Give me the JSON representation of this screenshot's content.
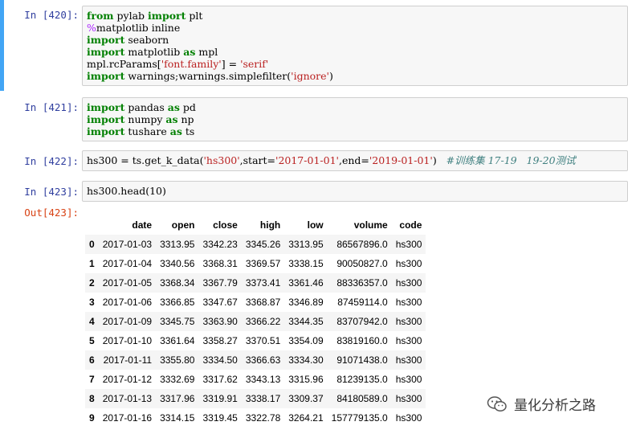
{
  "cells": [
    {
      "prompt": "In  [420]:",
      "code_lines": [
        [
          {
            "t": "from",
            "c": "kw"
          },
          {
            "t": " pylab ",
            "c": "op"
          },
          {
            "t": "import",
            "c": "kw"
          },
          {
            "t": " plt",
            "c": "op"
          }
        ],
        [
          {
            "t": "%",
            "c": "mg"
          },
          {
            "t": "matplotlib inline",
            "c": "op"
          }
        ],
        [
          {
            "t": "import",
            "c": "kw"
          },
          {
            "t": " seaborn",
            "c": "op"
          }
        ],
        [
          {
            "t": "import",
            "c": "kw"
          },
          {
            "t": " matplotlib ",
            "c": "op"
          },
          {
            "t": "as",
            "c": "kw"
          },
          {
            "t": " mpl",
            "c": "op"
          }
        ],
        [
          {
            "t": "mpl.rcParams[",
            "c": "op"
          },
          {
            "t": "'font.family'",
            "c": "str"
          },
          {
            "t": "] = ",
            "c": "op"
          },
          {
            "t": "'serif'",
            "c": "str"
          }
        ],
        [
          {
            "t": "import",
            "c": "kw"
          },
          {
            "t": " warnings;warnings.simplefilter(",
            "c": "op"
          },
          {
            "t": "'ignore'",
            "c": "str"
          },
          {
            "t": ")",
            "c": "op"
          }
        ]
      ]
    },
    {
      "prompt": "In  [421]:",
      "code_lines": [
        [
          {
            "t": "import",
            "c": "kw"
          },
          {
            "t": " pandas ",
            "c": "op"
          },
          {
            "t": "as",
            "c": "kw"
          },
          {
            "t": " pd",
            "c": "op"
          }
        ],
        [
          {
            "t": "import",
            "c": "kw"
          },
          {
            "t": " numpy ",
            "c": "op"
          },
          {
            "t": "as",
            "c": "kw"
          },
          {
            "t": " np",
            "c": "op"
          }
        ],
        [
          {
            "t": "import",
            "c": "kw"
          },
          {
            "t": " tushare ",
            "c": "op"
          },
          {
            "t": "as",
            "c": "kw"
          },
          {
            "t": " ts",
            "c": "op"
          }
        ]
      ]
    },
    {
      "prompt": "In  [422]:",
      "code_lines": [
        [
          {
            "t": "hs300 = ts.get_k_data(",
            "c": "op"
          },
          {
            "t": "'hs300'",
            "c": "str"
          },
          {
            "t": ",start=",
            "c": "op"
          },
          {
            "t": "'2017-01-01'",
            "c": "str"
          },
          {
            "t": ",end=",
            "c": "op"
          },
          {
            "t": "'2019-01-01'",
            "c": "str"
          },
          {
            "t": ")   ",
            "c": "op"
          },
          {
            "t": "#训练集 17-19   19-20测试",
            "c": "cmt"
          }
        ]
      ]
    },
    {
      "prompt": "In  [423]:",
      "code_lines": [
        [
          {
            "t": "hs300.head(10)",
            "c": "op"
          }
        ]
      ]
    }
  ],
  "output": {
    "prompt": "Out[423]:",
    "columns": [
      "",
      "date",
      "open",
      "close",
      "high",
      "low",
      "volume",
      "code"
    ],
    "rows": [
      [
        "0",
        "2017-01-03",
        "3313.95",
        "3342.23",
        "3345.26",
        "3313.95",
        "86567896.0",
        "hs300"
      ],
      [
        "1",
        "2017-01-04",
        "3340.56",
        "3368.31",
        "3369.57",
        "3338.15",
        "90050827.0",
        "hs300"
      ],
      [
        "2",
        "2017-01-05",
        "3368.34",
        "3367.79",
        "3373.41",
        "3361.46",
        "88336357.0",
        "hs300"
      ],
      [
        "3",
        "2017-01-06",
        "3366.85",
        "3347.67",
        "3368.87",
        "3346.89",
        "87459114.0",
        "hs300"
      ],
      [
        "4",
        "2017-01-09",
        "3345.75",
        "3363.90",
        "3366.22",
        "3344.35",
        "83707942.0",
        "hs300"
      ],
      [
        "5",
        "2017-01-10",
        "3361.64",
        "3358.27",
        "3370.51",
        "3354.09",
        "83819160.0",
        "hs300"
      ],
      [
        "6",
        "2017-01-11",
        "3355.80",
        "3334.50",
        "3366.63",
        "3334.30",
        "91071438.0",
        "hs300"
      ],
      [
        "7",
        "2017-01-12",
        "3332.69",
        "3317.62",
        "3343.13",
        "3315.96",
        "81239135.0",
        "hs300"
      ],
      [
        "8",
        "2017-01-13",
        "3317.96",
        "3319.91",
        "3338.17",
        "3309.37",
        "84180589.0",
        "hs300"
      ],
      [
        "9",
        "2017-01-16",
        "3314.15",
        "3319.45",
        "3322.78",
        "3264.21",
        "157779135.0",
        "hs300"
      ]
    ]
  },
  "watermark": {
    "icon": "wechat-icon",
    "text": "量化分析之路"
  },
  "colors": {
    "active_cell_border": "#42a5f5",
    "in_prompt": "#303f9f",
    "out_prompt": "#d84315",
    "keyword": "#008000",
    "string": "#ba2121",
    "magic": "#aa22ff",
    "comment": "#408080"
  }
}
